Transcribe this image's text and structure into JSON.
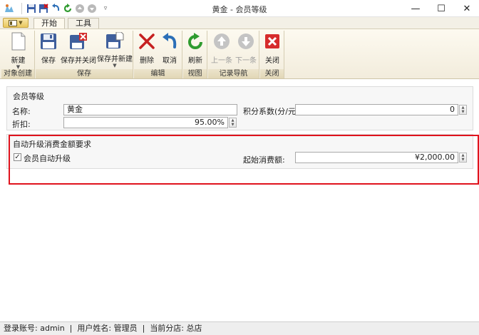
{
  "window": {
    "title": "黄金 - 会员等级",
    "minimize": "—",
    "maximize": "☐",
    "close": "✕"
  },
  "tabs": [
    {
      "label": "开始",
      "active": true
    },
    {
      "label": "工具",
      "active": false
    }
  ],
  "ribbon": {
    "groups": [
      {
        "label": "对象创建",
        "buttons": [
          {
            "label": "新建",
            "icon": "new-document-icon",
            "dropdown": true
          }
        ]
      },
      {
        "label": "保存",
        "buttons": [
          {
            "label": "保存",
            "icon": "floppy-disk-icon"
          },
          {
            "label": "保存并关闭",
            "icon": "save-close-icon"
          },
          {
            "label": "保存并新建",
            "icon": "save-new-icon",
            "dropdown": true
          }
        ]
      },
      {
        "label": "编辑",
        "buttons": [
          {
            "label": "删除",
            "icon": "delete-x-icon"
          },
          {
            "label": "取消",
            "icon": "undo-arrow-icon"
          }
        ]
      },
      {
        "label": "视图",
        "buttons": [
          {
            "label": "刷新",
            "icon": "refresh-icon"
          }
        ]
      },
      {
        "label": "记录导航",
        "buttons": [
          {
            "label": "上一条",
            "icon": "arrow-up-circle-icon",
            "disabled": true
          },
          {
            "label": "下一条",
            "icon": "arrow-down-circle-icon",
            "disabled": true
          }
        ]
      },
      {
        "label": "关闭",
        "buttons": [
          {
            "label": "关闭",
            "icon": "close-red-icon"
          }
        ]
      }
    ]
  },
  "form": {
    "section1": {
      "title": "会员等级",
      "name_label": "名称:",
      "name_value": "黄金",
      "points_label": "积分系数(分/元):",
      "points_value": "0",
      "discount_label": "折扣:",
      "discount_value": "95.00%"
    },
    "section2": {
      "title": "自动升级消费金额要求",
      "auto_upgrade_label": "会员自动升级",
      "auto_upgrade_checked": true,
      "start_amount_label": "起始消费额:",
      "start_amount_value": "¥2,000.00"
    }
  },
  "status": {
    "account_label": "登录账号:",
    "account_value": "admin",
    "user_label": "用户姓名:",
    "user_value": "管理员",
    "branch_label": "当前分店:",
    "branch_value": "总店"
  },
  "colors": {
    "highlight": "#e0131d",
    "ribbon_bg": "#f2ecdc",
    "app_button": "#e9c85e"
  }
}
